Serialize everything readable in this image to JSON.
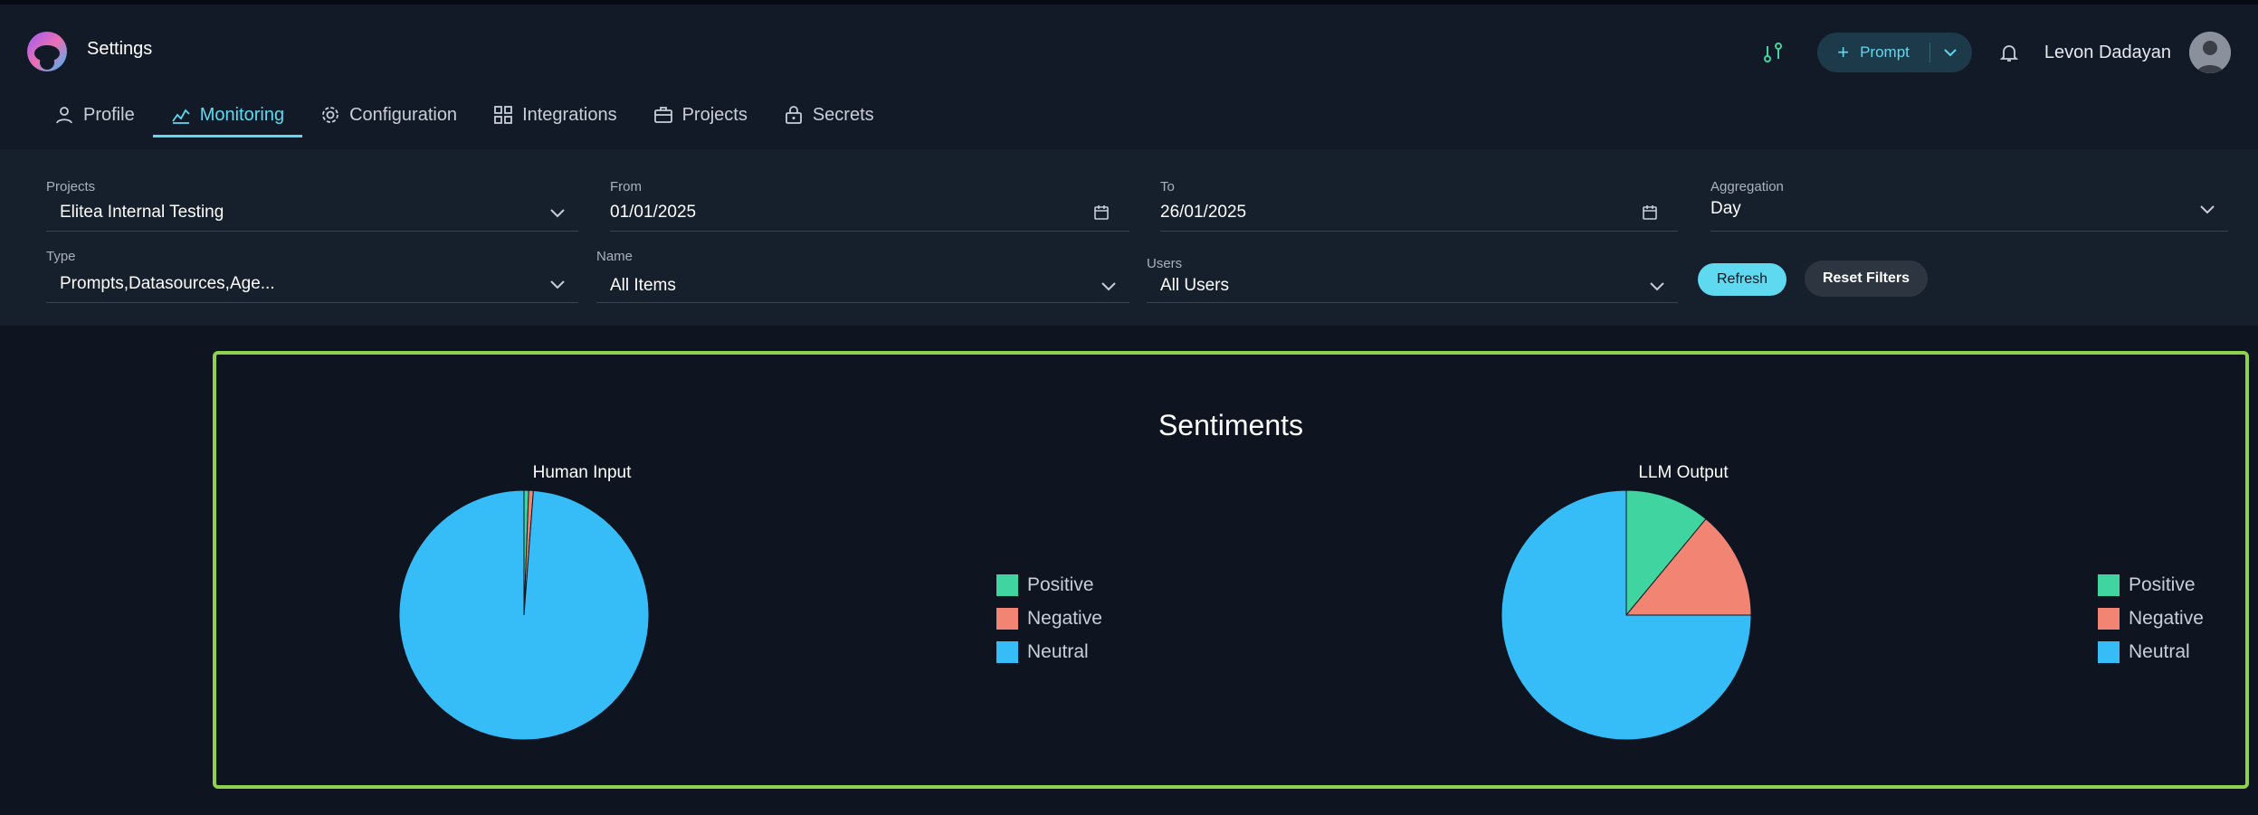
{
  "app": {
    "title": "Settings"
  },
  "tabs": [
    {
      "label": "Profile",
      "icon": "user-icon",
      "active": false
    },
    {
      "label": "Monitoring",
      "icon": "monitoring-icon",
      "active": true
    },
    {
      "label": "Configuration",
      "icon": "gear-icon",
      "active": false
    },
    {
      "label": "Integrations",
      "icon": "grid-icon",
      "active": false
    },
    {
      "label": "Projects",
      "icon": "briefcase-icon",
      "active": false
    },
    {
      "label": "Secrets",
      "icon": "lock-icon",
      "active": false
    }
  ],
  "header": {
    "prompt_label": "Prompt",
    "user_name": "Levon Dadayan"
  },
  "filters": {
    "projects": {
      "label": "Projects",
      "value": "Elitea Internal Testing"
    },
    "from": {
      "label": "From",
      "value": "01/01/2025"
    },
    "to": {
      "label": "To",
      "value": "26/01/2025"
    },
    "aggregation": {
      "label": "Aggregation",
      "value": "Day"
    },
    "type": {
      "label": "Type",
      "value": "Prompts,Datasources,Age..."
    },
    "name": {
      "label": "Name",
      "value": "All Items"
    },
    "users": {
      "label": "Users",
      "value": "All Users"
    },
    "refresh_label": "Refresh",
    "reset_label": "Reset Filters"
  },
  "colors": {
    "positive": "#40d4a0",
    "negative": "#f28474",
    "neutral": "#36bdf7",
    "accent": "#5fd9f0",
    "panel_border": "#8fd14f"
  },
  "chart_data": {
    "type": "pie",
    "title": "Sentiments",
    "legend_labels": [
      "Positive",
      "Negative",
      "Neutral"
    ],
    "charts": [
      {
        "title": "Human Input",
        "values": [
          0.6,
          0.6,
          98.8
        ]
      },
      {
        "title": "LLM Output",
        "values": [
          11,
          14,
          75
        ]
      }
    ]
  }
}
